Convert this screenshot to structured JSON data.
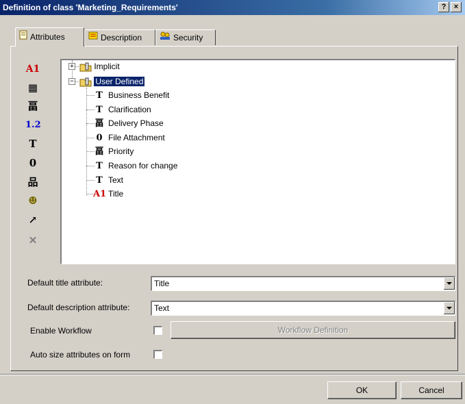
{
  "window": {
    "title": "Definition of class 'Marketing_Requirements'",
    "help_label": "?",
    "close_label": "×"
  },
  "tabs": [
    {
      "label": "Attributes",
      "icon": "document-icon",
      "active": true
    },
    {
      "label": "Description",
      "icon": "note-icon",
      "active": false
    },
    {
      "label": "Security",
      "icon": "users-icon",
      "active": false
    }
  ],
  "toolbar": [
    {
      "name": "title-attribute-tool",
      "glyph": "A1",
      "color": "#cc0000"
    },
    {
      "name": "date-attribute-tool",
      "glyph": "▦",
      "color": "#000000"
    },
    {
      "name": "list-attribute-tool",
      "glyph": "畐",
      "color": "#000000"
    },
    {
      "name": "number-attribute-tool",
      "glyph": "1.2",
      "color": "#0000cc"
    },
    {
      "name": "text-attribute-tool",
      "glyph": "T",
      "color": "#000000"
    },
    {
      "name": "attachment-attribute-tool",
      "glyph": "𝟎",
      "color": "#000000"
    },
    {
      "name": "hierarchy-attribute-tool",
      "glyph": "品",
      "color": "#000000"
    },
    {
      "name": "user-attribute-tool",
      "glyph": "☻",
      "color": "#7a6a00"
    },
    {
      "name": "link-attribute-tool",
      "glyph": "↗",
      "color": "#000000"
    },
    {
      "name": "delete-attribute-tool",
      "glyph": "✕",
      "color": "#808080"
    }
  ],
  "tree": {
    "groups": [
      {
        "label": "Implicit",
        "expander": "+"
      },
      {
        "label": "User Defined",
        "expander": "−"
      }
    ],
    "attributes": [
      {
        "label": "Business Benefit",
        "glyph": "T",
        "color": "#000000"
      },
      {
        "label": "Clarification",
        "glyph": "T",
        "color": "#000000"
      },
      {
        "label": "Delivery Phase",
        "glyph": "畐",
        "color": "#000000"
      },
      {
        "label": "File Attachment",
        "glyph": "𝟎",
        "color": "#000000"
      },
      {
        "label": "Priority",
        "glyph": "畐",
        "color": "#000000"
      },
      {
        "label": "Reason for change",
        "glyph": "T",
        "color": "#000000"
      },
      {
        "label": "Text",
        "glyph": "T",
        "color": "#000000"
      },
      {
        "label": "Title",
        "glyph": "A1",
        "color": "#cc0000"
      }
    ]
  },
  "form": {
    "default_title_label": "Default title attribute:",
    "default_title_value": "Title",
    "default_desc_label": "Default description attribute:",
    "default_desc_value": "Text",
    "enable_workflow_label": "Enable Workflow",
    "workflow_button_label": "Workflow Definition",
    "auto_size_label": "Auto size attributes on form"
  },
  "buttons": {
    "ok": "OK",
    "cancel": "Cancel"
  }
}
